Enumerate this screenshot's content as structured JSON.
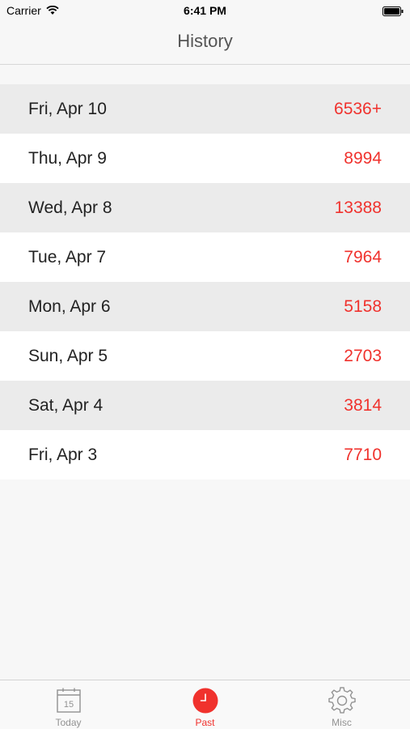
{
  "status_bar": {
    "carrier": "Carrier",
    "time": "6:41 PM"
  },
  "nav": {
    "title": "History"
  },
  "history": [
    {
      "date": "Fri, Apr 10",
      "value": "6536+"
    },
    {
      "date": "Thu, Apr 9",
      "value": "8994"
    },
    {
      "date": "Wed, Apr 8",
      "value": "13388"
    },
    {
      "date": "Tue, Apr 7",
      "value": "7964"
    },
    {
      "date": "Mon, Apr 6",
      "value": "5158"
    },
    {
      "date": "Sun, Apr 5",
      "value": "2703"
    },
    {
      "date": "Sat, Apr 4",
      "value": "3814"
    },
    {
      "date": "Fri, Apr 3",
      "value": "7710"
    }
  ],
  "tabs": [
    {
      "label": "Today",
      "icon": "calendar-icon",
      "calendar_day": "15"
    },
    {
      "label": "Past",
      "icon": "clock-icon",
      "active": true
    },
    {
      "label": "Misc",
      "icon": "gear-icon"
    }
  ],
  "colors": {
    "accent": "#f0322d",
    "inactive": "#929292",
    "row_shaded": "#ebebeb",
    "row_plain": "#ffffff"
  }
}
